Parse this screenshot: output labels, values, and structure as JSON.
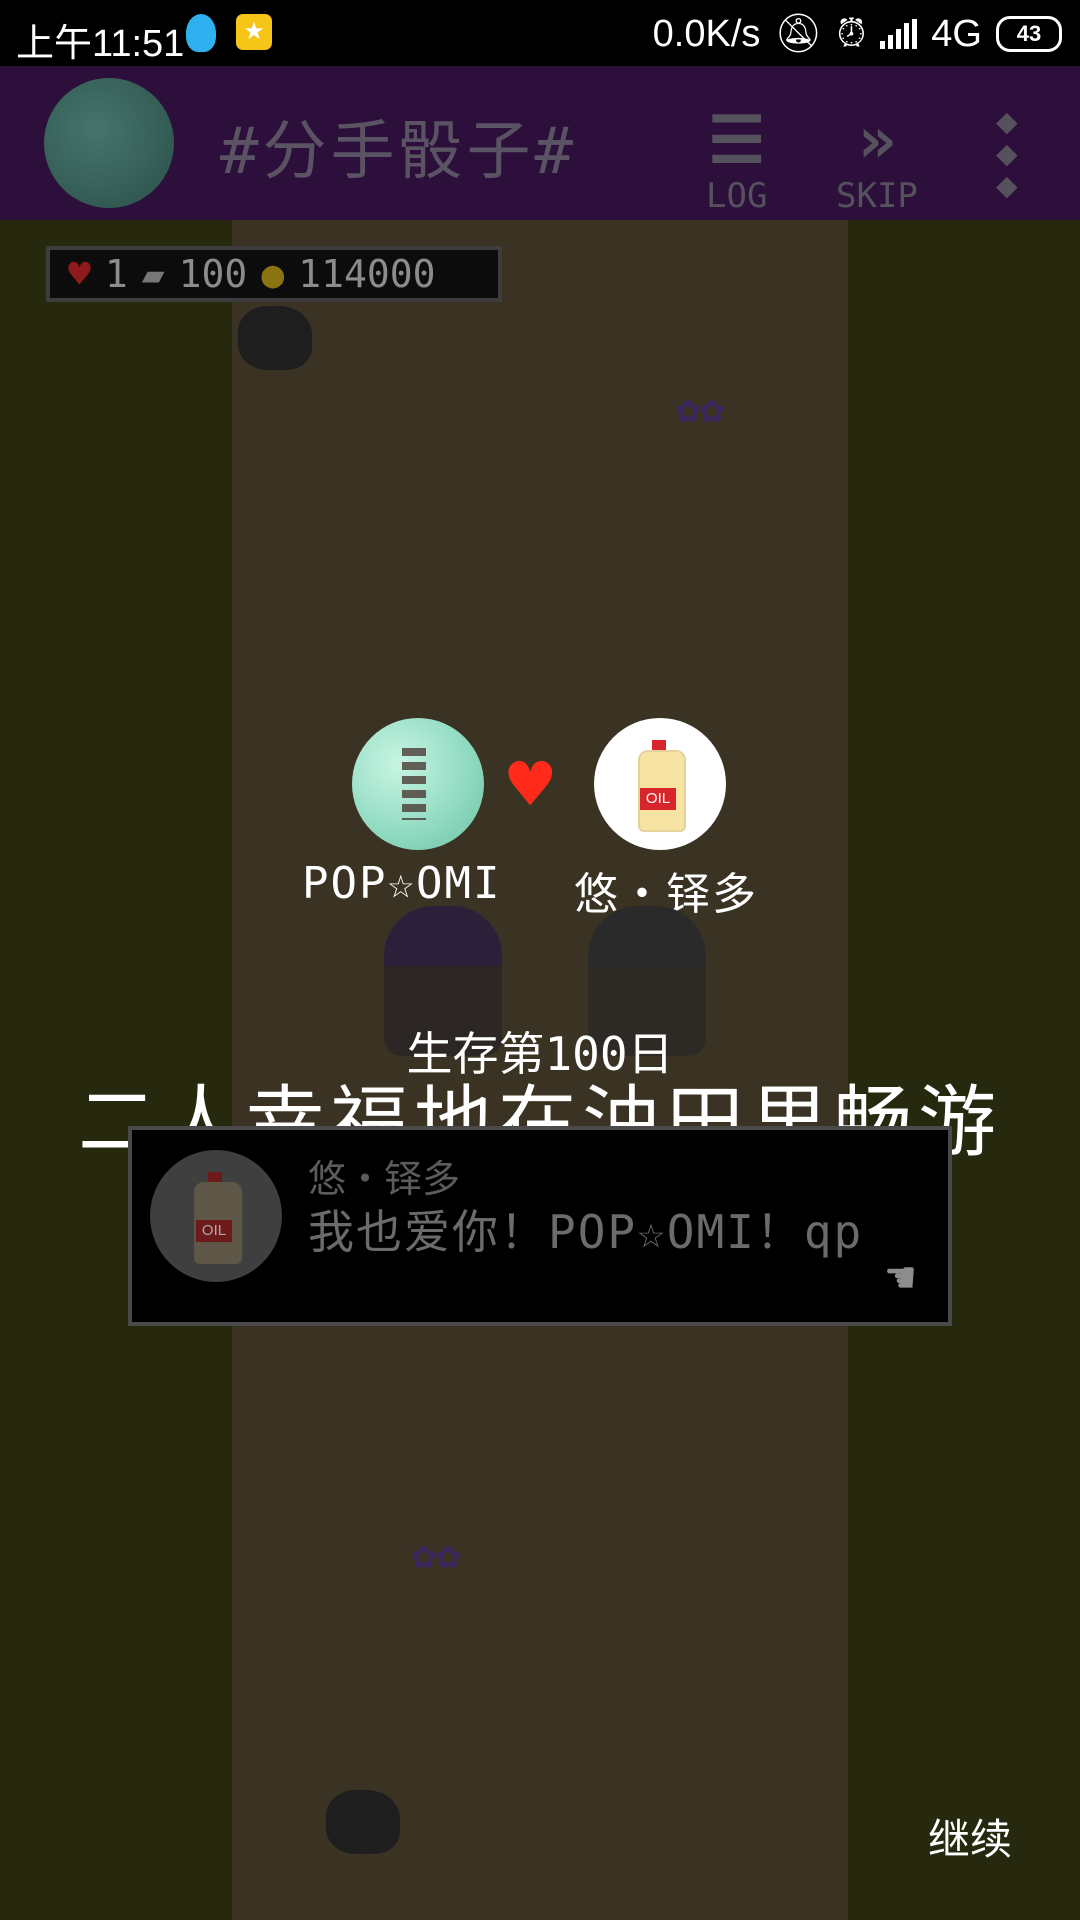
{
  "status_bar": {
    "time": "上午11:51",
    "network_speed": "0.0K/s",
    "network_type": "4G",
    "battery": "43",
    "icons": [
      "qq-icon",
      "app-star-icon",
      "mute-bell-icon",
      "alarm-icon",
      "signal-icon",
      "battery-icon"
    ]
  },
  "app_bar": {
    "title": "#分手骰子#",
    "log_label": "LOG",
    "skip_label": "SKIP",
    "icons": [
      "avatar-icecream",
      "log-icon",
      "skip-icon",
      "more-icon"
    ]
  },
  "hud": {
    "hearts": "1",
    "books": "100",
    "coins": "114000"
  },
  "couple": {
    "left_name": "POP☆OMI",
    "right_name": "悠・铎多",
    "icons": [
      "ice-cream-avatar",
      "heart-icon",
      "oil-bottle-avatar"
    ]
  },
  "event": {
    "day": "生存第100日",
    "headline": "二人幸福地在油田里畅游"
  },
  "dialog": {
    "speaker": "悠・铎多",
    "text": "我也爱你！POP☆OMI！qp"
  },
  "continue_label": "继续",
  "colors": {
    "app_bar_bg": "#2c0f3a",
    "grass": "#27290f",
    "path": "#3a3222",
    "heart": "#ff2a1a",
    "mint": "#8ed9c0"
  }
}
